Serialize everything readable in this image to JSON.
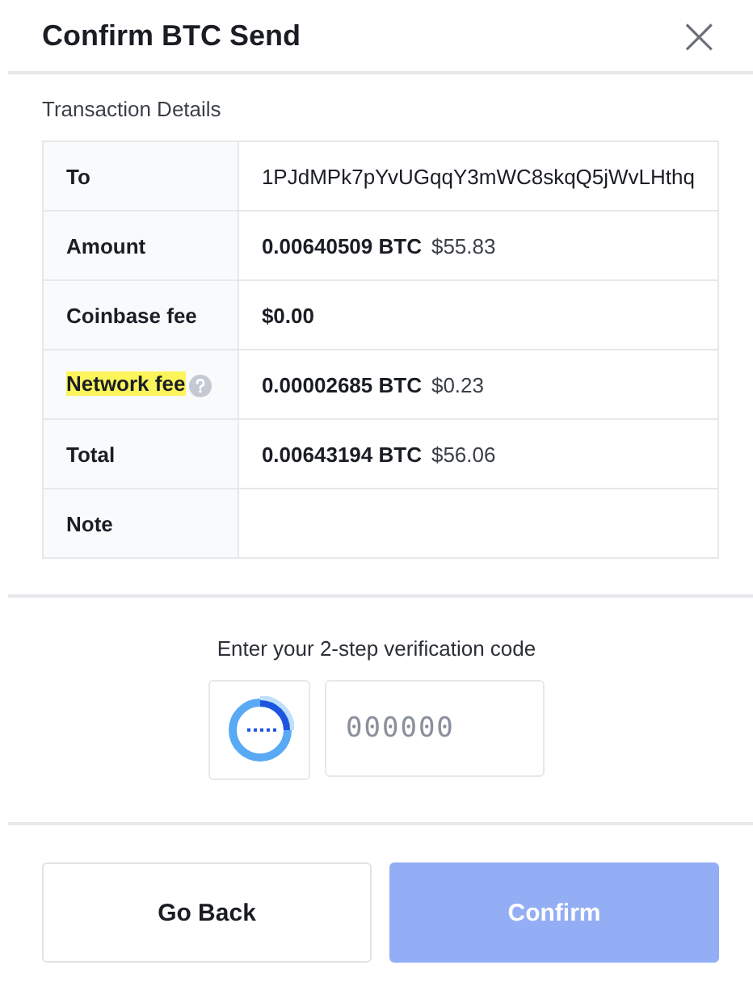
{
  "dialog": {
    "title": "Confirm BTC Send",
    "close": "×"
  },
  "details": {
    "heading": "Transaction Details",
    "rows": [
      {
        "label": "To",
        "highlighted": false,
        "help": false,
        "value": "1PJdMPk7pYvUGqqY3mWC8skqQ5jWvLHthq"
      },
      {
        "label": "Amount",
        "highlighted": false,
        "help": false,
        "btc": "0.00640509 BTC",
        "usd": "$55.83"
      },
      {
        "label": "Coinbase fee",
        "highlighted": false,
        "help": false,
        "btc": "$0.00"
      },
      {
        "label": "Network fee",
        "highlighted": true,
        "help": true,
        "btc": "0.00002685 BTC",
        "usd": "$0.23"
      },
      {
        "label": "Total",
        "highlighted": false,
        "help": false,
        "btc": "0.00643194 BTC",
        "usd": "$56.06"
      },
      {
        "label": "Note",
        "highlighted": false,
        "help": false
      }
    ]
  },
  "verification": {
    "prompt": "Enter your 2-step verification code",
    "placeholder": "000000"
  },
  "buttons": [
    {
      "label": "Go Back",
      "disabled": false
    },
    {
      "label": "Confirm",
      "disabled": true
    }
  ]
}
